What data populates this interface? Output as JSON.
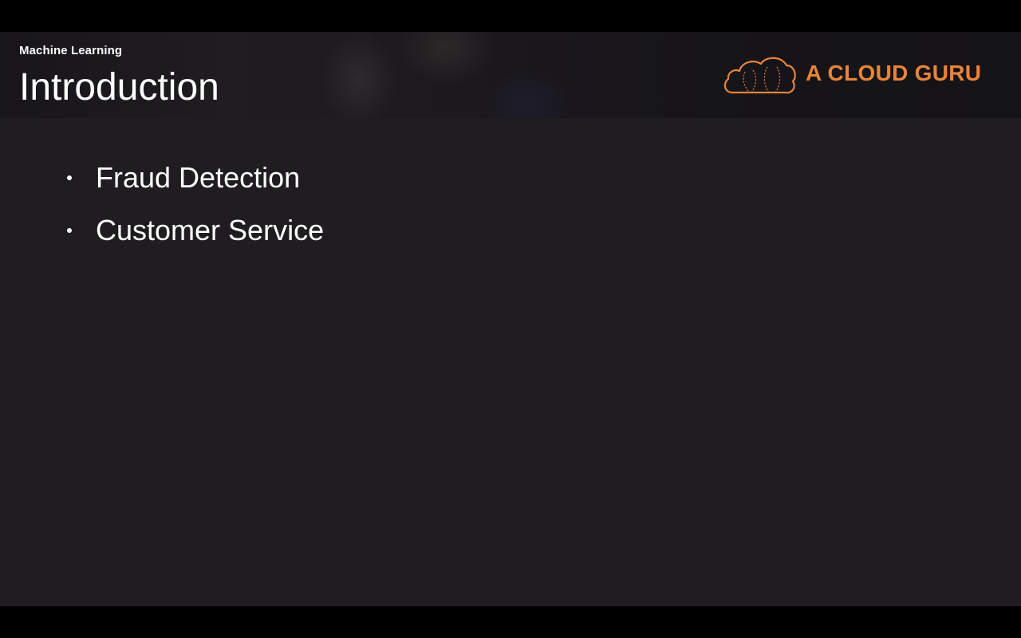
{
  "slide": {
    "section": "Machine Learning",
    "title": "Introduction",
    "logo": {
      "text": "A CLOUD GURU",
      "icon": "cloud-icon",
      "color": "#e8843a"
    },
    "bullets": [
      "Fraud Detection",
      "Customer Service"
    ]
  },
  "colors": {
    "background": "#1f1d20",
    "letterbox": "#000000",
    "text": "#ffffff",
    "accent": "#e8843a"
  }
}
